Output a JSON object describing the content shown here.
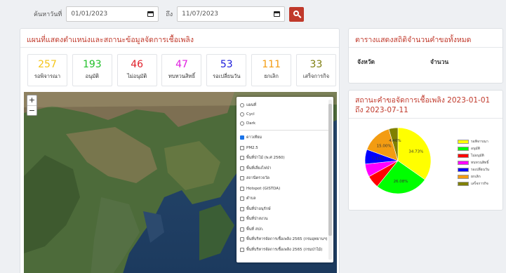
{
  "search": {
    "label": "ค้นหาวันที่",
    "start_date": "01/01/2023",
    "to_label": "ถึง",
    "end_date": "11/07/2023"
  },
  "main_panel": {
    "title": "แผนที่แสดงตำแหน่งและสถานะข้อมูลจัดการเชื้อเพลิง",
    "statuses": [
      {
        "count": "257",
        "label": "รอพิจารณา",
        "color": "#f5c518"
      },
      {
        "count": "193",
        "label": "อนุมัติ",
        "color": "#22c02a"
      },
      {
        "count": "46",
        "label": "ไม่อนุมัติ",
        "color": "#e0202a"
      },
      {
        "count": "47",
        "label": "ทบทวนสิทธิ์",
        "color": "#e020e0"
      },
      {
        "count": "53",
        "label": "รอเปลี่ยนวัน",
        "color": "#1a1adb"
      },
      {
        "count": "111",
        "label": "ยกเลิก",
        "color": "#f39c12"
      },
      {
        "count": "33",
        "label": "เสร็จการกิจ",
        "color": "#7d7d0e"
      }
    ]
  },
  "map": {
    "zoom_in": "+",
    "zoom_out": "−",
    "base_layers": [
      {
        "label": "แผนที่",
        "selected": false
      },
      {
        "label": "Cycl",
        "selected": false
      },
      {
        "label": "Dark",
        "selected": false
      }
    ],
    "overlays": [
      {
        "label": "ดาวเทียม",
        "checked": true
      },
      {
        "label": "PM2.5",
        "checked": false
      },
      {
        "label": "พื้นที่ป่าไม้ (พ.ศ 2560)",
        "checked": false
      },
      {
        "label": "พื้นที่เสี่ยงไฟป่า",
        "checked": false
      },
      {
        "label": "สถานีตรวจวัด",
        "checked": false
      },
      {
        "label": "Hotspot (GISTDA)",
        "checked": false
      },
      {
        "label": "ตำบล",
        "checked": false
      },
      {
        "label": "พื้นที่ป่าอนุรักษ์",
        "checked": false
      },
      {
        "label": "พื้นที่ป่าสงวน",
        "checked": false
      },
      {
        "label": "พื้นที่ สปก.",
        "checked": false
      },
      {
        "label": "พื้นที่บริหารจัดการเชื้อเพลิง 2565 (กรมอุทยานฯ)",
        "checked": false
      },
      {
        "label": "พื้นที่บริหารจัดการเชื้อเพลิง 2565 (กรมป่าไม้)",
        "checked": false
      }
    ]
  },
  "stats_panel": {
    "title": "ตารางแสดงสถิติจำนวนคำขอทั้งหมด",
    "columns": [
      "จังหวัด",
      "จำนวน"
    ]
  },
  "pie_panel": {
    "title": "สถานะคำขอจัดการเชื้อเพลิง 2023-01-01 ถึง 2023-07-11"
  },
  "chart_data": {
    "type": "pie",
    "title": "",
    "slices": [
      {
        "label": "รอพิจารณา",
        "value": 34.73,
        "value_label": "34.73%",
        "color": "#ffff00"
      },
      {
        "label": "อนุมัติ",
        "value": 26.08,
        "value_label": "26.08%",
        "color": "#00ff00"
      },
      {
        "label": "ไม่อนุมัติ",
        "value": 6.22,
        "value_label": "",
        "color": "#ff0000"
      },
      {
        "label": "ทบทวนสิทธิ์",
        "value": 6.35,
        "value_label": "",
        "color": "#ff00ff"
      },
      {
        "label": "รอเปลี่ยนวัน",
        "value": 7.16,
        "value_label": "7.16%",
        "color": "#0000ff"
      },
      {
        "label": "ยกเลิก",
        "value": 15.0,
        "value_label": "15.00%",
        "color": "#f39c12"
      },
      {
        "label": "เสร็จการกิจ",
        "value": 4.46,
        "value_label": "4.46%",
        "color": "#808000"
      }
    ],
    "legend_position": "right"
  }
}
